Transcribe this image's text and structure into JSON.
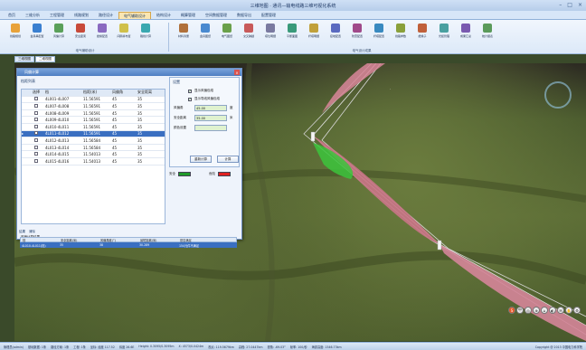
{
  "app": {
    "title": "三维地图 · 通讯—输电线路三维可视化系统"
  },
  "tabs": [
    {
      "label": "首页",
      "active": false
    },
    {
      "label": "三维分析",
      "active": false
    },
    {
      "label": "工程管理",
      "active": false
    },
    {
      "label": "线路规划",
      "active": false
    },
    {
      "label": "路径设计",
      "active": false
    },
    {
      "label": "电气辅助设计",
      "active": true
    },
    {
      "label": "结构设计",
      "active": false
    },
    {
      "label": "概算管理",
      "active": false
    },
    {
      "label": "空间数据管理",
      "active": false
    },
    {
      "label": "数据导出",
      "active": false
    },
    {
      "label": "配置管理",
      "active": false
    }
  ],
  "ribbon": {
    "group1_label": "电气辅助设计",
    "group2_label": "电气设计成果",
    "group1": [
      {
        "label": "线路规划",
        "color": "#e8a23a"
      },
      {
        "label": "金具串配置",
        "color": "#3a7fd0"
      },
      {
        "label": "风偏计算",
        "color": "#5aa05a"
      },
      {
        "label": "安全距离",
        "color": "#c84a3a"
      },
      {
        "label": "绝缘配置",
        "color": "#8a6ac0"
      },
      {
        "label": "间隔棒布置",
        "color": "#d0c04a"
      },
      {
        "label": "跳线计算",
        "color": "#3aa8b0"
      }
    ],
    "group2": [
      {
        "label": "材料清册",
        "color": "#b0703a"
      },
      {
        "label": "金具图纸",
        "color": "#4a8ad0"
      },
      {
        "label": "电气图纸",
        "color": "#6aa04a"
      },
      {
        "label": "交叉跨越",
        "color": "#c85a5a"
      },
      {
        "label": "塔位明细",
        "color": "#7a7aa0"
      },
      {
        "label": "平断面图",
        "color": "#3a9a7a"
      },
      {
        "label": "杆塔明细",
        "color": "#c0a03a"
      },
      {
        "label": "接地配置",
        "color": "#5a6ac0"
      },
      {
        "label": "防雷配置",
        "color": "#a04a8a"
      },
      {
        "label": "杆塔配置",
        "color": "#3a8ac0"
      },
      {
        "label": "线路参数",
        "color": "#8aa03a"
      },
      {
        "label": "绝缘子",
        "color": "#c0603a"
      },
      {
        "label": "光缆管理",
        "color": "#4aa0a0"
      },
      {
        "label": "成果汇总",
        "color": "#7a5ab0"
      },
      {
        "label": "统计报表",
        "color": "#5a9a5a"
      }
    ]
  },
  "subtabs": [
    {
      "label": "三维视图",
      "active": false
    },
    {
      "label": "二维视图",
      "active": true
    }
  ],
  "dialog": {
    "title": "风偏计算",
    "close": "×",
    "grid_caption": "档距列表",
    "columns": [
      "选择",
      "档",
      "档距(米)",
      "风偏角",
      "安全距离"
    ],
    "rows": [
      {
        "id": "4L001-4L007",
        "span": "11.56591",
        "angle": "45",
        "dist": "35",
        "selected": false
      },
      {
        "id": "4L007-4L008",
        "span": "11.56591",
        "angle": "45",
        "dist": "35",
        "selected": false
      },
      {
        "id": "4L008-4L009",
        "span": "11.56591",
        "angle": "45",
        "dist": "35",
        "selected": false
      },
      {
        "id": "4L009-4L010",
        "span": "11.56591",
        "angle": "45",
        "dist": "35",
        "selected": false
      },
      {
        "id": "4L010-4L011",
        "span": "11.56591",
        "angle": "45",
        "dist": "35",
        "selected": false
      },
      {
        "id": "4L011-4L012",
        "span": "11.56591",
        "angle": "45",
        "dist": "35",
        "selected": true
      },
      {
        "id": "4L012-4L013",
        "span": "11.56584",
        "angle": "45",
        "dist": "35",
        "selected": false
      },
      {
        "id": "4L013-4L014",
        "span": "11.56584",
        "angle": "45",
        "dist": "35",
        "selected": false
      },
      {
        "id": "4L014-4L015",
        "span": "11.54013",
        "angle": "45",
        "dist": "35",
        "selected": false
      },
      {
        "id": "4L015-4L016",
        "span": "11.54013",
        "angle": "45",
        "dist": "35",
        "selected": false
      }
    ],
    "settings_caption": "设置",
    "check1": "显示风偏包络",
    "check2": "显示导线风偏包络",
    "field1_label": "风偏角",
    "field1_value": "45.00",
    "field1_unit": "度",
    "field2_label": "安全距离",
    "field2_value": "35.00",
    "field2_unit": "米",
    "field3_label": "颜色设置",
    "field3_value": "",
    "btn_calc": "重新计算",
    "btn_ok": "计算",
    "legend_safe": "安全",
    "legend_safe_color": "#1f9a2a",
    "legend_danger": "危险",
    "legend_danger_color": "#e02020",
    "lower_tab1": "结果",
    "lower_tab2": "清除",
    "lower_caption": "风偏计算结果",
    "lower_columns": [
      "档",
      "安全距离(米)",
      "风偏角度(°)",
      "最短距离(米)",
      "是否满足"
    ],
    "lower_row": [
      "4L010-4L011(档)",
      "35",
      "38",
      "30.289",
      "154元件不满足"
    ]
  },
  "view_tools": [
    "S",
    "中",
    "◎",
    "⊕",
    "⌂",
    "◐",
    "✉",
    "✋",
    "⚙"
  ],
  "status": {
    "items": [
      "管理员(admin)",
      "基础数据: 1条",
      "路径方案: 1条",
      "工程: 1条",
      "坐标: 经度 117.52",
      "纬度 26.6E",
      "Height: 0.3095/0.3095m",
      "X: 4573/0.0424m",
      "视点: 119.5679km",
      "高程: 27.0447km",
      "视角: -69.03°",
      "帧率: 100/秒",
      "海拔高度: 1546.73km"
    ],
    "copyright": "Copyright @ 2013 中国电力科学院"
  }
}
